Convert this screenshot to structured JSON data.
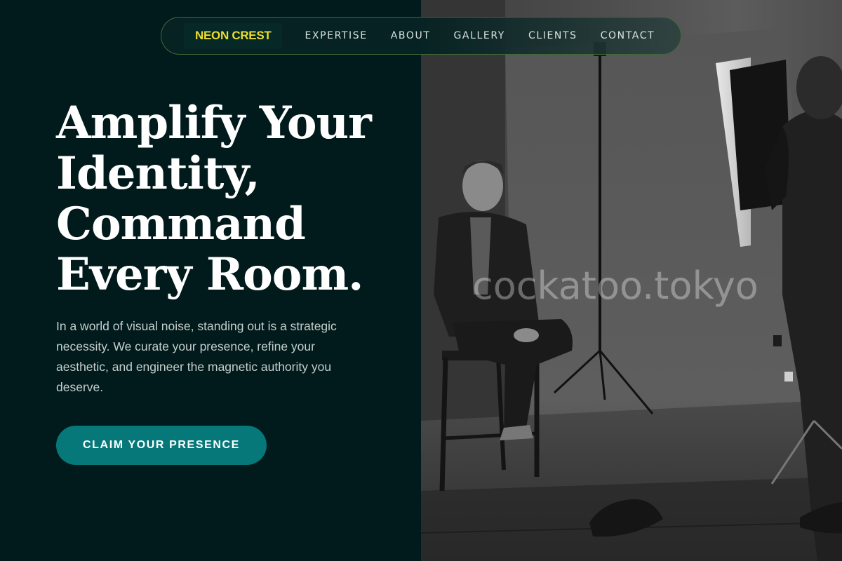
{
  "nav": {
    "brand": "NEON CREST",
    "items": [
      {
        "label": "EXPERTISE"
      },
      {
        "label": "ABOUT"
      },
      {
        "label": "GALLERY"
      },
      {
        "label": "CLIENTS"
      },
      {
        "label": "CONTACT"
      }
    ]
  },
  "hero": {
    "title_lines": [
      "Amplify Your",
      "Identity,",
      "Command",
      "Every Room."
    ],
    "body": "In a world of visual noise, standing out is a strategic necessity. We curate your presence, refine your aesthetic, and engineer the magnetic authority you deserve.",
    "cta_label": "CLAIM YOUR PRESENCE"
  },
  "watermark": "cockatoo.tokyo",
  "colors": {
    "background": "#011a1b",
    "brand_text": "#ebdd2f",
    "cta": "#06787a",
    "nav_border": "#3d6b3a"
  }
}
